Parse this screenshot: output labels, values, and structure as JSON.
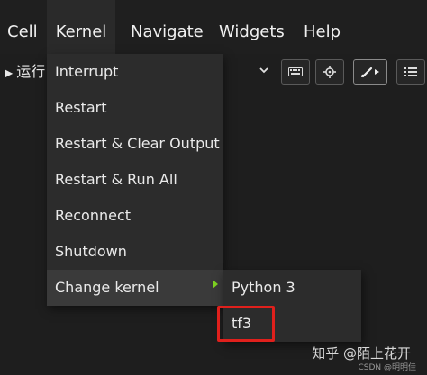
{
  "menubar": {
    "items": [
      "Cell",
      "Kernel",
      "Navigate",
      "Widgets",
      "Help"
    ]
  },
  "toolbar": {
    "run_label": "运行",
    "buttons": [
      "keyboard-icon",
      "crosshair-icon",
      "brush-icon",
      "list-icon"
    ]
  },
  "kernel_menu": {
    "items": [
      "Interrupt",
      "Restart",
      "Restart & Clear Output",
      "Restart & Run All",
      "Reconnect",
      "Shutdown",
      "Change kernel"
    ],
    "submenu": [
      "Python 3",
      "tf3"
    ]
  },
  "colors": {
    "accent_arrow": "#7ed321",
    "highlight": "#e0201c"
  },
  "watermark": {
    "text": "知乎 @陌上花开",
    "credit": "CSDN @明明佳"
  }
}
